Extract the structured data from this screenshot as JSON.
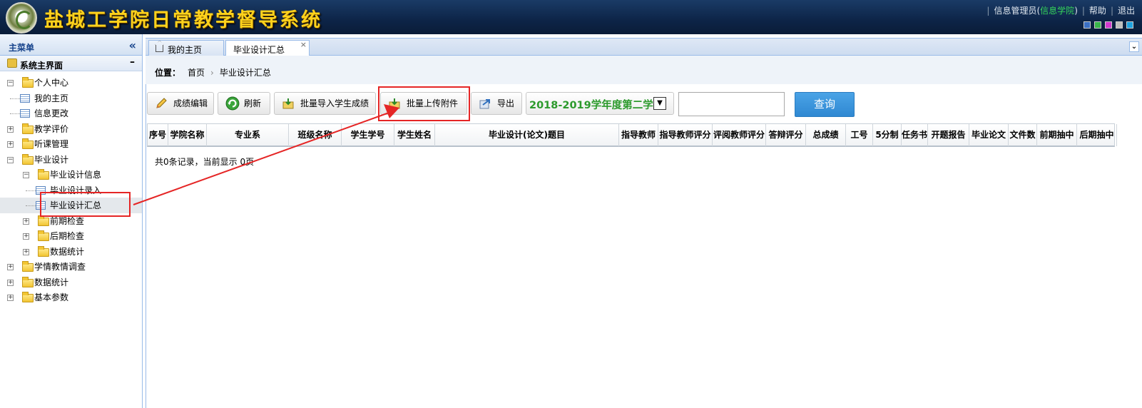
{
  "app": {
    "title": "盐城工学院日常教学督导系统"
  },
  "topbar": {
    "role": "信息管理员",
    "paren_open": "(",
    "dept": "信息学院",
    "paren_close": ")",
    "help": "帮助",
    "logout": "退出"
  },
  "theme_colors": [
    "#3a6fc4",
    "#39b54a",
    "#d23ad0",
    "#bdbdbd",
    "#1fa3e0"
  ],
  "sidebar": {
    "title": "主菜单",
    "section": "系统主界面",
    "tree": [
      {
        "label": "个人中心",
        "level": 0,
        "type": "folder",
        "state": "open"
      },
      {
        "label": "我的主页",
        "level": 1,
        "type": "page"
      },
      {
        "label": "信息更改",
        "level": 1,
        "type": "page"
      },
      {
        "label": "教学评价",
        "level": 0,
        "type": "folder",
        "state": "closed"
      },
      {
        "label": "听课管理",
        "level": 0,
        "type": "folder",
        "state": "closed"
      },
      {
        "label": "毕业设计",
        "level": 0,
        "type": "folder",
        "state": "open"
      },
      {
        "label": "毕业设计信息",
        "level": 1,
        "type": "folder",
        "state": "open"
      },
      {
        "label": "毕业设计录入",
        "level": 2,
        "type": "page"
      },
      {
        "label": "毕业设计汇总",
        "level": 2,
        "type": "page",
        "selected": true
      },
      {
        "label": "前期检查",
        "level": 1,
        "type": "folder",
        "state": "closed"
      },
      {
        "label": "后期检查",
        "level": 1,
        "type": "folder",
        "state": "closed"
      },
      {
        "label": "数据统计",
        "level": 1,
        "type": "folder",
        "state": "closed"
      },
      {
        "label": "学情教情调查",
        "level": 0,
        "type": "folder",
        "state": "closed"
      },
      {
        "label": "数据统计",
        "level": 0,
        "type": "folder",
        "state": "closed"
      },
      {
        "label": "基本参数",
        "level": 0,
        "type": "folder",
        "state": "closed"
      }
    ]
  },
  "tabs": [
    {
      "label": "我的主页"
    },
    {
      "label": "毕业设计汇总",
      "active": true,
      "close": "×"
    }
  ],
  "breadcrumb": {
    "prefix": "位置：",
    "home": "首页",
    "current": "毕业设计汇总"
  },
  "toolbar": {
    "edit_scores": "成绩编辑",
    "refresh": "刷新",
    "batch_import_scores": "批量导入学生成绩",
    "batch_upload_attachments": "批量上传附件",
    "export": "导出",
    "term_select": "2018-2019学年度第二学期",
    "search_value": "",
    "query": "查询"
  },
  "table": {
    "columns": [
      "序号",
      "学院名称",
      "专业系",
      "班级名称",
      "学生学号",
      "学生姓名",
      "毕业设计(论文)题目",
      "指导教师",
      "指导教师评分",
      "评阅教师评分",
      "答辩评分",
      "总成绩",
      "工号",
      "5分制",
      "任务书",
      "开题报告",
      "毕业论文",
      "文件数",
      "前期抽中",
      "后期抽中"
    ],
    "rows": [],
    "summary": "共0条记录，当前显示 0页"
  }
}
